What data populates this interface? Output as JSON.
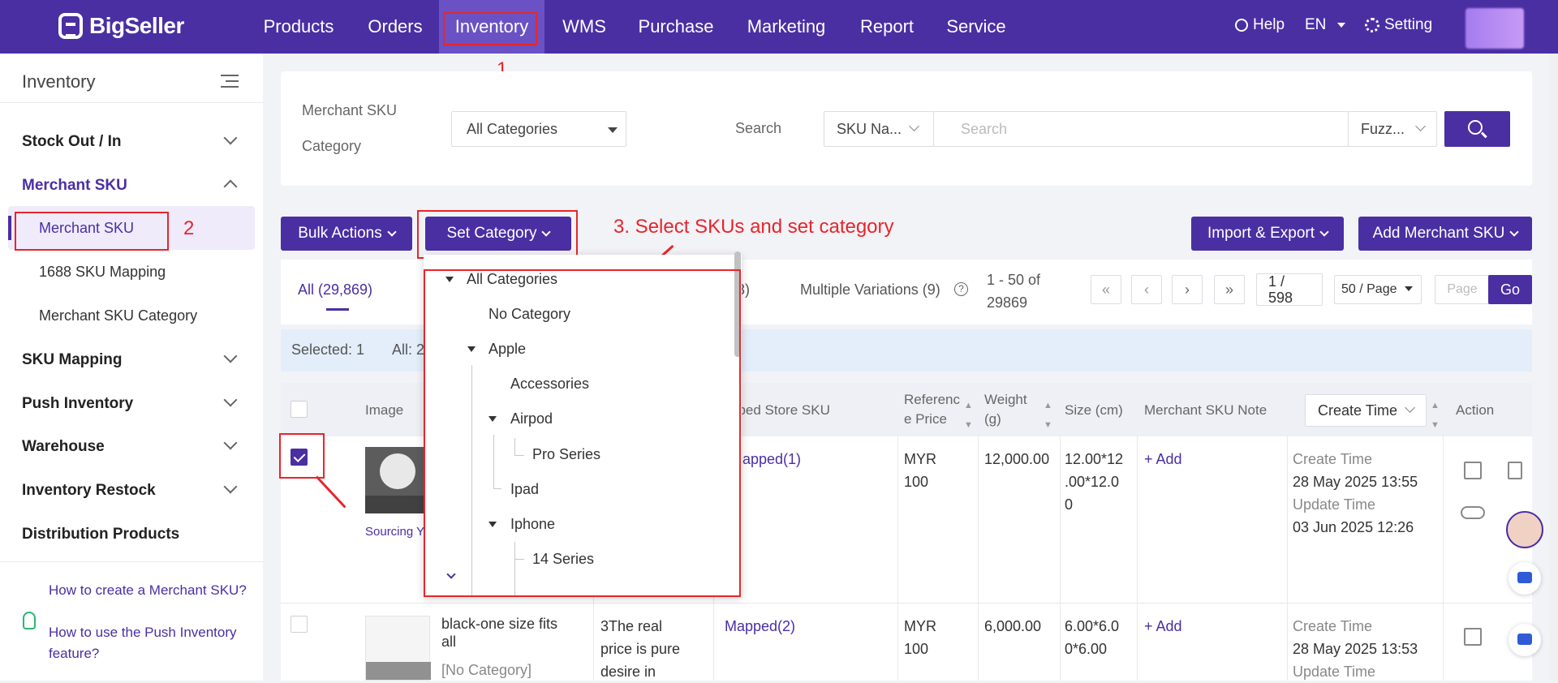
{
  "app": {
    "brand": "BigSeller"
  },
  "topnav": {
    "items": [
      "Products",
      "Orders",
      "Inventory",
      "WMS",
      "Purchase",
      "Marketing",
      "Report",
      "Service"
    ],
    "help": "Help",
    "lang": "EN",
    "setting": "Setting"
  },
  "annotations": {
    "n1": "1",
    "n2": "2",
    "n3": "3. Select SKUs and set category",
    "color": "#e8252a"
  },
  "sidebar": {
    "title": "Inventory",
    "groups": [
      "Stock Out / In",
      "Merchant SKU",
      "SKU Mapping",
      "Push Inventory",
      "Warehouse",
      "Inventory Restock",
      "Distribution Products"
    ],
    "sub": [
      "Merchant SKU",
      "1688 SKU Mapping",
      "Merchant SKU Category"
    ],
    "help1": "How to create a Merchant SKU?",
    "help2": "How to use the Push Inventory feature?"
  },
  "filter": {
    "category_label_1": "Merchant SKU",
    "category_label_2": "Category",
    "category_value": "All Categories",
    "search_label": "Search",
    "search_field": "SKU Na...",
    "search_placeholder": "Search",
    "match_mode": "Fuzz..."
  },
  "toolbar": {
    "bulk": "Bulk Actions",
    "set_category": "Set Category",
    "import_export": "Import & Export",
    "add_sku": "Add Merchant SKU"
  },
  "tabs": {
    "all": "All (29,869)",
    "hidden_count": "3)",
    "multi": "Multiple Variations (9)",
    "range_1": "1 - 50 of",
    "range_2": "29869",
    "page_1": "1 /",
    "page_2": "598",
    "per_page": "50 / Page",
    "page_placeholder": "Page",
    "go": "Go"
  },
  "selection": {
    "selected": "Selected: 1",
    "all": "All: 2"
  },
  "table": {
    "headers": {
      "image": "Image",
      "mapped": "pped Store SKU",
      "ref1": "Referenc",
      "ref2": "e Price",
      "weight1": "Weight",
      "weight2": "(g)",
      "size": "Size (cm)",
      "note": "Merchant SKU Note",
      "create_time": "Create Time",
      "action": "Action"
    },
    "rows": [
      {
        "source": "Sourcing Y",
        "mapped": "Mapped(1)",
        "ref_1": "MYR",
        "ref_2": "100",
        "weight": "12,000.00",
        "size_1": "12.00*12",
        "size_2": ".00*12.0",
        "size_3": "0",
        "note": "+ Add",
        "create_label": "Create Time",
        "create": "28 May 2025 13:55",
        "update_label": "Update Time",
        "update": "03 Jun 2025 12:26"
      },
      {
        "name_1": "black-one size fits",
        "name_2": "all",
        "category": "[No Category]",
        "title_1": "3The real",
        "title_2": "price is pure",
        "title_3": "desire in",
        "mapped": "Mapped(2)",
        "ref_1": "MYR",
        "ref_2": "100",
        "weight": "6,000.00",
        "size_1": "6.00*6.0",
        "size_2": "0*6.00",
        "note": "+ Add",
        "create_label": "Create Time",
        "create": "28 May 2025 13:53",
        "update_label": "Update Time"
      }
    ]
  },
  "category_tree": {
    "root": "All Categories",
    "items": [
      "No Category",
      "Apple",
      "Accessories",
      "Airpod",
      "Pro Series",
      "Ipad",
      "Iphone",
      "14 Series"
    ]
  },
  "colors": {
    "primary": "#4a2fa3",
    "header": "#4a2fa3"
  }
}
